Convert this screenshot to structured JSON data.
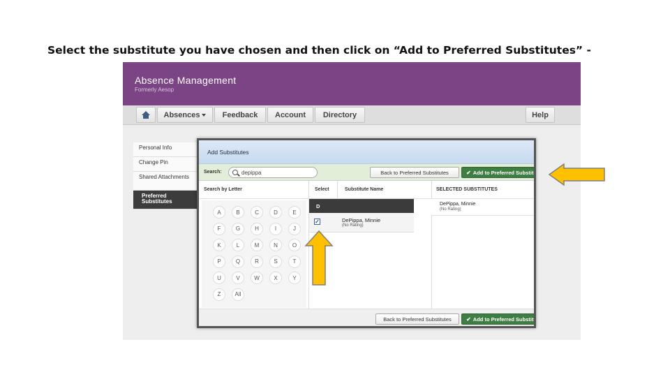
{
  "caption": "Select the substitute you have chosen and then click on “Add to Preferred Substitutes” -",
  "header": {
    "title": "Absence Management",
    "subtitle": "Formerly Aesop"
  },
  "nav": {
    "home_icon": "home-icon",
    "absences": "Absences",
    "feedback": "Feedback",
    "account": "Account",
    "directory": "Directory",
    "help": "Help"
  },
  "sidebar": {
    "items": [
      {
        "label": "Personal Info"
      },
      {
        "label": "Change Pin"
      },
      {
        "label": "Shared Attachments"
      },
      {
        "label": "Preferred Substitutes"
      }
    ]
  },
  "modal": {
    "title": "Add Substitutes",
    "search_label": "Search:",
    "search_value": "depippa",
    "back_label": "Back to Preferred Substitutes",
    "add_label": "Add to Preferred Substitutes",
    "col_letter": "Search by Letter",
    "col_select": "Select",
    "col_name": "Substitute Name",
    "col_selected": "SELECTED SUBSTITUTES",
    "letters": [
      "A",
      "B",
      "C",
      "D",
      "E",
      "F",
      "G",
      "H",
      "I",
      "J",
      "K",
      "L",
      "M",
      "N",
      "O",
      "P",
      "Q",
      "R",
      "S",
      "T",
      "U",
      "V",
      "W",
      "X",
      "Y",
      "Z",
      "All"
    ],
    "group_letter": "D",
    "result": {
      "name": "DePippa, Minnie",
      "status": "(No Rating)",
      "checked": true
    },
    "selected": {
      "name": "DePippa, Minnie",
      "status": "(No Rating)"
    },
    "remove_symbol": "×",
    "check_symbol": "✔",
    "checkbox_symbol": "✓"
  },
  "annotations": {
    "arrow_color": "#ffc000",
    "arrow_outline": "#7f7f7f"
  }
}
